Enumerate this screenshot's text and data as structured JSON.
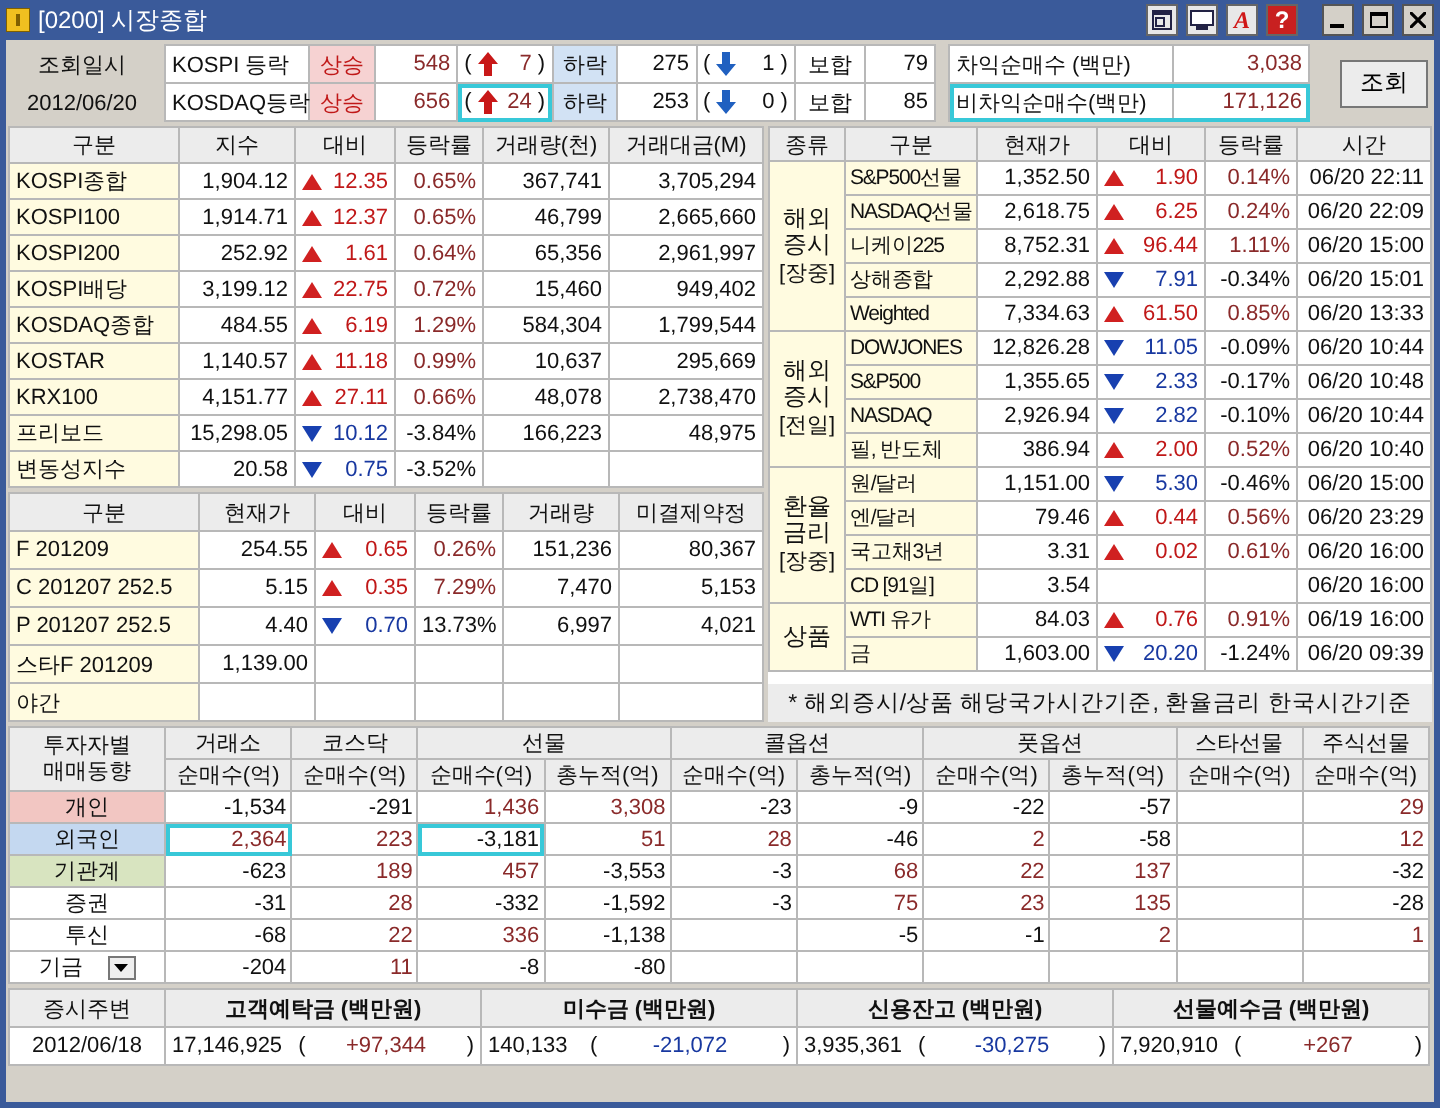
{
  "window": {
    "title": "[0200] 시장종합",
    "tools": [
      {
        "kind": "layout"
      },
      {
        "kind": "screen"
      },
      {
        "kind": "text",
        "label": "A"
      },
      {
        "kind": "text",
        "label": "?"
      }
    ]
  },
  "header": {
    "date_label": "조회일시",
    "date": "2012/06/20",
    "breadth": [
      {
        "market": "KOSPI 등락",
        "up_label": "상승",
        "up": "548",
        "up_change": [
          "(",
          "7",
          ")"
        ],
        "down_label": "하락",
        "down": "275",
        "down_change": [
          "(",
          "1",
          ")"
        ],
        "flat_label": "보합",
        "flat": "79",
        "highlighted": false
      },
      {
        "market": "KOSDAQ등락",
        "up_label": "상승",
        "up": "656",
        "up_change": [
          "(",
          "24",
          ")"
        ],
        "down_label": "하락",
        "down": "253",
        "down_change": [
          "(",
          "0",
          ")"
        ],
        "flat_label": "보합",
        "flat": "85",
        "highlighted": true
      }
    ],
    "arbitrage": [
      {
        "label": "차익순매수  (백만)",
        "value": "3,038",
        "highlighted": false
      },
      {
        "label": "비차익순매수(백만)",
        "value": "171,126",
        "highlighted": true
      }
    ],
    "query_button": "조회"
  },
  "index_table": {
    "columns": [
      "구분",
      "지수",
      "대비",
      "등락률",
      "거래량(천)",
      "거래대금(M)"
    ],
    "rows": [
      {
        "name": "KOSPI종합",
        "value": "1,904.12",
        "rising": true,
        "change": "12.35",
        "rate": "0.65%",
        "volume": "367,741",
        "amount": "3,705,294"
      },
      {
        "name": "KOSPI100",
        "value": "1,914.71",
        "rising": true,
        "change": "12.37",
        "rate": "0.65%",
        "volume": "46,799",
        "amount": "2,665,660"
      },
      {
        "name": "KOSPI200",
        "value": "252.92",
        "rising": true,
        "change": "1.61",
        "rate": "0.64%",
        "volume": "65,356",
        "amount": "2,961,997"
      },
      {
        "name": "KOSPI배당",
        "value": "3,199.12",
        "rising": true,
        "change": "22.75",
        "rate": "0.72%",
        "volume": "15,460",
        "amount": "949,402"
      },
      {
        "name": "KOSDAQ종합",
        "value": "484.55",
        "rising": true,
        "change": "6.19",
        "rate": "1.29%",
        "volume": "584,304",
        "amount": "1,799,544"
      },
      {
        "name": "KOSTAR",
        "value": "1,140.57",
        "rising": true,
        "change": "11.18",
        "rate": "0.99%",
        "volume": "10,637",
        "amount": "295,669"
      },
      {
        "name": "KRX100",
        "value": "4,151.77",
        "rising": true,
        "change": "27.11",
        "rate": "0.66%",
        "volume": "48,078",
        "amount": "2,738,470"
      },
      {
        "name": "프리보드",
        "value": "15,298.05",
        "rising": false,
        "change": "10.12",
        "rate": "-3.84%",
        "volume": "166,223",
        "amount": "48,975"
      },
      {
        "name": "변동성지수",
        "value": "20.58",
        "rising": false,
        "change": "0.75",
        "rate": "-3.52%"
      }
    ]
  },
  "futures_table": {
    "columns": [
      "구분",
      "현재가",
      "대비",
      "등락률",
      "거래량",
      "미결제약정"
    ],
    "rows": [
      {
        "name": "F 201209",
        "value": "254.55",
        "rising": true,
        "change": "0.65",
        "rate": "0.26%",
        "volume": "151,236",
        "amount": "80,367"
      },
      {
        "name": "C 201207 252.5",
        "value": "5.15",
        "rising": true,
        "change": "0.35",
        "rate": "7.29%",
        "volume": "7,470",
        "amount": "5,153"
      },
      {
        "name": "P 201207 252.5",
        "value": "4.40",
        "rising": false,
        "change": "0.70",
        "rate": "13.73%",
        "volume": "6,997",
        "amount": "4,021"
      },
      {
        "name": "스타F 201209",
        "value": "1,139.00"
      },
      {
        "name": "야간"
      }
    ]
  },
  "world_table": {
    "columns": [
      "종류",
      "구분",
      "현재가",
      "대비",
      "등락률",
      "시간"
    ],
    "groups": [
      {
        "label": [
          "해외",
          "증시"
        ],
        "tag": "[장중]",
        "rows": [
          {
            "name": "S&P500선물",
            "value": "1,352.50",
            "rising": true,
            "change": "1.90",
            "rate": "0.14%",
            "time": "06/20 22:11"
          },
          {
            "name": "NASDAQ선물",
            "value": "2,618.75",
            "rising": true,
            "change": "6.25",
            "rate": "0.24%",
            "time": "06/20 22:09"
          },
          {
            "name": "니케이225",
            "value": "8,752.31",
            "rising": true,
            "change": "96.44",
            "rate": "1.11%",
            "time": "06/20 15:00"
          },
          {
            "name": "상해종합",
            "value": "2,292.88",
            "rising": false,
            "change": "7.91",
            "rate": "-0.34%",
            "time": "06/20 15:01"
          },
          {
            "name": "Weighted",
            "value": "7,334.63",
            "rising": true,
            "change": "61.50",
            "rate": "0.85%",
            "time": "06/20 13:33"
          }
        ]
      },
      {
        "label": [
          "해외",
          "증시"
        ],
        "tag": "[전일]",
        "rows": [
          {
            "name": "DOWJONES",
            "value": "12,826.28",
            "rising": false,
            "change": "11.05",
            "rate": "-0.09%",
            "time": "06/20 10:44"
          },
          {
            "name": "S&P500",
            "value": "1,355.65",
            "rising": false,
            "change": "2.33",
            "rate": "-0.17%",
            "time": "06/20 10:48"
          },
          {
            "name": "NASDAQ",
            "value": "2,926.94",
            "rising": false,
            "change": "2.82",
            "rate": "-0.10%",
            "time": "06/20 10:44"
          },
          {
            "name": "필, 반도체",
            "value": "386.94",
            "rising": true,
            "change": "2.00",
            "rate": "0.52%",
            "time": "06/20 10:40"
          }
        ]
      },
      {
        "label": [
          "환율",
          "금리"
        ],
        "tag": "[장중]",
        "rows": [
          {
            "name": "원/달러",
            "value": "1,151.00",
            "rising": false,
            "change": "5.30",
            "rate": "-0.46%",
            "time": "06/20 15:00"
          },
          {
            "name": "엔/달러",
            "value": "79.46",
            "rising": true,
            "change": "0.44",
            "rate": "0.56%",
            "time": "06/20 23:29"
          },
          {
            "name": "국고채3년",
            "value": "3.31",
            "rising": true,
            "change": "0.02",
            "rate": "0.61%",
            "time": "06/20 16:00"
          },
          {
            "name": "CD [91일]",
            "value": "3.54",
            "time": "06/20 16:00"
          }
        ]
      },
      {
        "label": [
          "상품"
        ],
        "rows": [
          {
            "name": "WTI 유가",
            "value": "84.03",
            "rising": true,
            "change": "0.76",
            "rate": "0.91%",
            "time": "06/19 16:00"
          },
          {
            "name": "금",
            "value": "1,603.00",
            "rising": false,
            "change": "20.20",
            "rate": "-1.24%",
            "time": "06/20 09:39"
          }
        ]
      }
    ],
    "note": "* 해외증시/상품 해당국가시간기준, 환율금리 한국시간기준"
  },
  "investors": {
    "corner": [
      "투자자별",
      "매매동향"
    ],
    "groups": [
      {
        "name": "거래소",
        "columns": [
          "순매수(억)"
        ]
      },
      {
        "name": "코스닥",
        "columns": [
          "순매수(억)"
        ]
      },
      {
        "name": "선물",
        "columns": [
          "순매수(억)",
          "총누적(억)"
        ]
      },
      {
        "name": "콜옵션",
        "columns": [
          "순매수(억)",
          "총누적(억)"
        ]
      },
      {
        "name": "풋옵션",
        "columns": [
          "순매수(억)",
          "총누적(억)"
        ]
      },
      {
        "name": "스타선물",
        "columns": [
          "순매수(억)"
        ]
      },
      {
        "name": "주식선물",
        "columns": [
          "순매수(억)"
        ]
      }
    ],
    "rows": [
      {
        "name": "개인",
        "kind": "plain",
        "color": "#f2c6c2",
        "cells": {
          "exchange": "-1,534",
          "kosdaq": "-291",
          "futures_net": "1,436",
          "futures_total": "3,308",
          "call_net": "-23",
          "call_total": "-9",
          "put_net": "-22",
          "put_total": "-57",
          "stock_futures": "29"
        }
      },
      {
        "name": "외국인",
        "kind": "plain",
        "color": "#c4d8f0",
        "cells": {
          "exchange": "2,364",
          "kosdaq": "223",
          "futures_net": "-3,181",
          "futures_total": "51",
          "call_net": "28",
          "call_total": "-46",
          "put_net": "2",
          "put_total": "-58",
          "stock_futures": "12"
        },
        "highlighted_columns": {
          "exchange": true,
          "futures_net": true
        }
      },
      {
        "name": "기관계",
        "kind": "plain",
        "color": "#d8e4c0",
        "cells": {
          "exchange": "-623",
          "kosdaq": "189",
          "futures_net": "457",
          "futures_total": "-3,553",
          "call_net": "-3",
          "call_total": "68",
          "put_net": "22",
          "put_total": "137",
          "stock_futures": "-32"
        }
      },
      {
        "name": "증권",
        "kind": "plain",
        "cells": {
          "exchange": "-31",
          "kosdaq": "28",
          "futures_net": "-332",
          "futures_total": "-1,592",
          "call_net": "-3",
          "call_total": "75",
          "put_net": "23",
          "put_total": "135",
          "stock_futures": "-28"
        }
      },
      {
        "name": "투신",
        "kind": "plain",
        "cells": {
          "exchange": "-68",
          "kosdaq": "22",
          "futures_net": "336",
          "futures_total": "-1,138",
          "call_total": "-5",
          "put_net": "-1",
          "put_total": "2",
          "stock_futures": "1"
        }
      },
      {
        "name": "기금",
        "kind": "dropdown",
        "cells": {
          "exchange": "-204",
          "kosdaq": "11",
          "futures_net": "-8",
          "futures_total": "-80"
        }
      }
    ]
  },
  "summary": {
    "corner": "증시주변",
    "date": "2012/06/18",
    "items": [
      {
        "label": "고객예탁금 (백만원)",
        "value": "17,146,925",
        "change": [
          "(",
          "+97,344",
          ")"
        ]
      },
      {
        "label": "미수금 (백만원)",
        "value": "140,133",
        "change": [
          "(",
          "-21,072",
          ")"
        ]
      },
      {
        "label": "신용잔고 (백만원)",
        "value": "3,935,361",
        "change": [
          "(",
          "-30,275",
          ")"
        ]
      },
      {
        "label": "선물예수금 (백만원)",
        "value": "7,920,910",
        "change": [
          "(",
          "+267",
          ")"
        ]
      }
    ]
  }
}
